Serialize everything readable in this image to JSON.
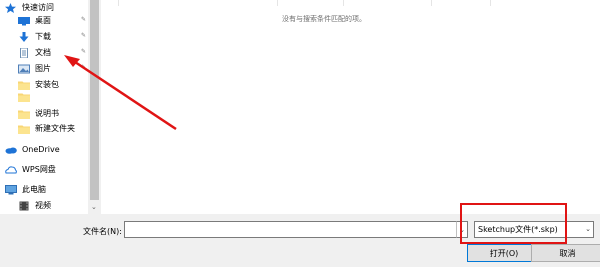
{
  "sidebar": {
    "quick_access": "快速访问",
    "items": [
      {
        "label": "桌面",
        "icon": "desktop-icon"
      },
      {
        "label": "下载",
        "icon": "download-icon"
      },
      {
        "label": "文档",
        "icon": "document-icon"
      },
      {
        "label": "图片",
        "icon": "pictures-icon"
      },
      {
        "label": "安装包",
        "icon": "folder-icon"
      },
      {
        "label": "说明书",
        "icon": "folder-icon"
      },
      {
        "label": "新建文件夹",
        "icon": "folder-icon"
      },
      {
        "label": "OneDrive",
        "icon": "onedrive-icon"
      },
      {
        "label": "WPS网盘",
        "icon": "wps-cloud-icon"
      },
      {
        "label": "此电脑",
        "icon": "this-pc-icon"
      },
      {
        "label": "视频",
        "icon": "video-icon"
      }
    ]
  },
  "content": {
    "empty_message": "没有与搜索条件匹配的项。"
  },
  "footer": {
    "filename_label": "文件名(N):",
    "filename_value": "",
    "filetype_value": "Sketchup文件(*.skp)",
    "open_label": "打开(O)",
    "cancel_label": "取消"
  },
  "colors": {
    "annotation": "#e01414",
    "accent": "#0078d7"
  }
}
